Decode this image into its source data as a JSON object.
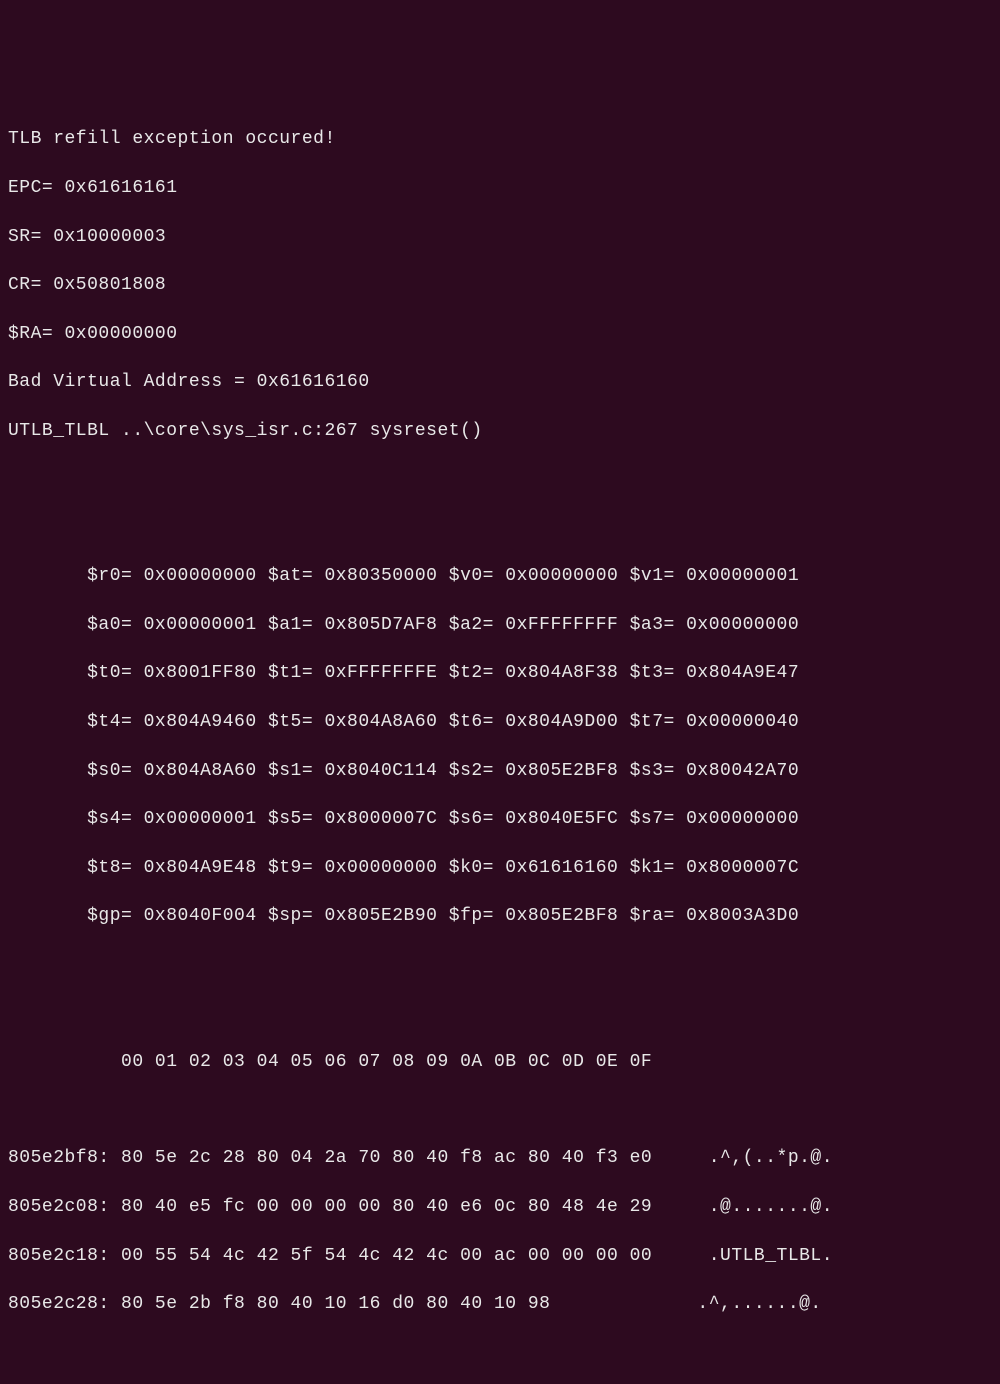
{
  "header": {
    "title": "TLB refill exception occured!",
    "epc": "EPC= 0x61616161",
    "sr": "SR= 0x10000003",
    "cr": "CR= 0x50801808",
    "ra": "$RA= 0x00000000",
    "bad_va": "Bad Virtual Address = 0x61616160",
    "source": "UTLB_TLBL ..\\core\\sys_isr.c:267 sysreset()"
  },
  "registers": {
    "row0": "       $r0= 0x00000000 $at= 0x80350000 $v0= 0x00000000 $v1= 0x00000001",
    "row1": "       $a0= 0x00000001 $a1= 0x805D7AF8 $a2= 0xFFFFFFFF $a3= 0x00000000",
    "row2": "       $t0= 0x8001FF80 $t1= 0xFFFFFFFE $t2= 0x804A8F38 $t3= 0x804A9E47",
    "row3": "       $t4= 0x804A9460 $t5= 0x804A8A60 $t6= 0x804A9D00 $t7= 0x00000040",
    "row4": "       $s0= 0x804A8A60 $s1= 0x8040C114 $s2= 0x805E2BF8 $s3= 0x80042A70",
    "row5": "       $s4= 0x00000001 $s5= 0x8000007C $s6= 0x8040E5FC $s7= 0x00000000",
    "row6": "       $t8= 0x804A9E48 $t9= 0x00000000 $k0= 0x61616160 $k1= 0x8000007C",
    "row7": "       $gp= 0x8040F004 $sp= 0x805E2B90 $fp= 0x805E2BF8 $ra= 0x8003A3D0"
  },
  "hexdump": {
    "header": "          00 01 02 03 04 05 06 07 08 09 0A 0B 0C 0D 0E 0F",
    "row0": "805e2bf8: 80 5e 2c 28 80 04 2a 70 80 40 f8 ac 80 40 f3 e0     .^,(..*p.@.",
    "row1": "805e2c08: 80 40 e5 fc 00 00 00 00 80 40 e6 0c 80 48 4e 29     .@.......@.",
    "row2": "805e2c18: 00 55 54 4c 42 5f 54 4c 42 4c 00 ac 00 00 00 00     .UTLB_TLBL.",
    "row3": "805e2c28: 80 5e 2b f8 80 40 10 16 d0 80 40 10 98             .^,......@."
  }
}
